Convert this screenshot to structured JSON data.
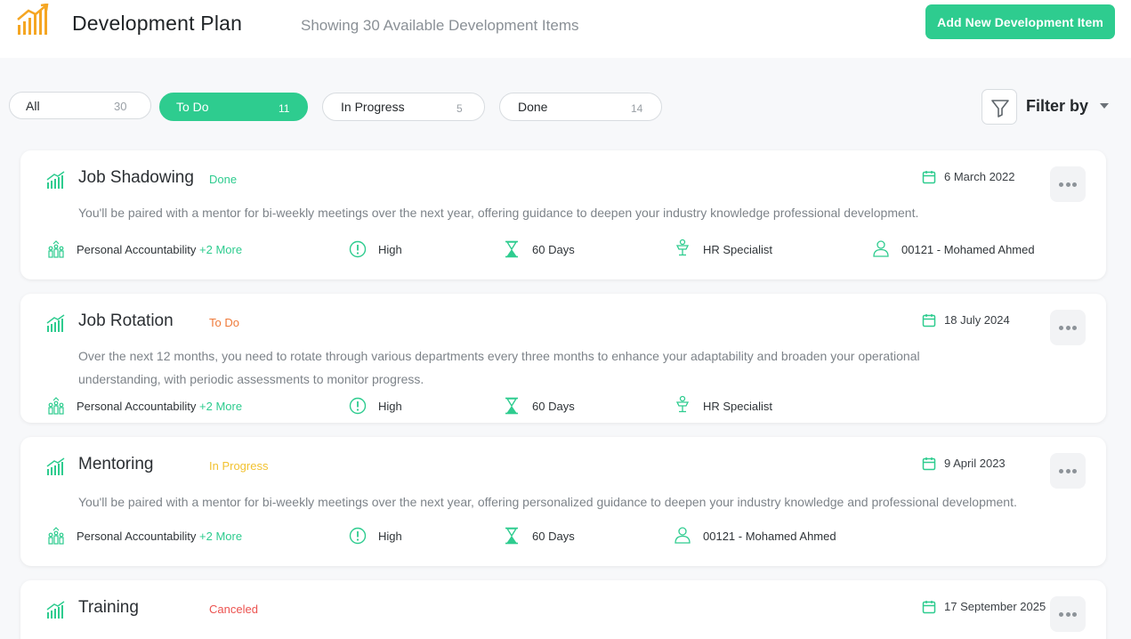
{
  "header": {
    "title": "Development Plan",
    "subtitle": "Showing 30 Available Development Items",
    "add_button": "Add New Development Item"
  },
  "filters": [
    {
      "label": "All",
      "count": "30",
      "active": false
    },
    {
      "label": "To Do",
      "count": "11",
      "active": true
    },
    {
      "label": "In Progress",
      "count": "5",
      "active": false
    },
    {
      "label": "Done",
      "count": "14",
      "active": false
    }
  ],
  "filter_by": "Filter by",
  "colors": {
    "accent": "#2ecc8f",
    "done": "#2ecc8f",
    "todo": "#ef7a3a",
    "in_progress": "#f2c230",
    "canceled": "#ec5350"
  },
  "cards": [
    {
      "title": "Job Shadowing",
      "status": "Done",
      "date": "6 March 2022",
      "description": "You'll be paired with a mentor for bi-weekly meetings over the next  year, offering  guidance to deepen your industry knowledge professional development.",
      "competency": "Personal Accountability",
      "more": "+2 More",
      "priority": "High",
      "duration": "60 Days",
      "role": "HR Specialist",
      "assignee": "00121 - Mohamed Ahmed"
    },
    {
      "title": "Job Rotation",
      "status": "To Do",
      "date": "18 July 2024",
      "description": "Over  the next 12 months, you need to rotate through various departments  every three months to enhance your adaptability and broaden your  operational understanding, with periodic assessments to monitor  progress.",
      "competency": "Personal Accountability",
      "more": "+2 More",
      "priority": "High",
      "duration": "60 Days",
      "role": "HR Specialist"
    },
    {
      "title": "Mentoring",
      "status": "In Progress",
      "date": "9 April 2023",
      "description": "You'll  be paired with a mentor for bi-weekly meetings over the next year,  offering personalized guidance to deepen your industry knowledge and  professional development.",
      "competency": "Personal Accountability",
      "more": "+2 More",
      "priority": "High",
      "duration": "60 Days",
      "assignee": "00121 - Mohamed Ahmed"
    },
    {
      "title": "Training",
      "status": "Canceled",
      "date": "17 September 2025"
    }
  ]
}
